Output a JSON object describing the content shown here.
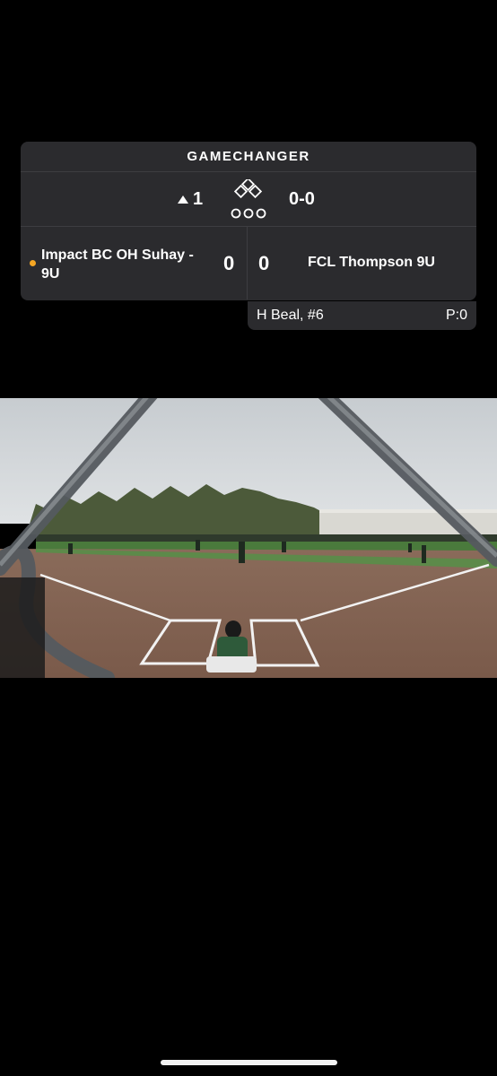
{
  "scoreboard": {
    "brand": "GAMECHANGER",
    "inning": "1",
    "inning_half": "top",
    "count": "0-0",
    "away_team": "Impact BC OH Suhay - 9U",
    "away_score": "0",
    "home_team": "FCL Thompson 9U",
    "home_score": "0",
    "possession_color": "#f5a623"
  },
  "batter": {
    "name": "H Beal, #6",
    "pitch_count": "P:0"
  },
  "video": {
    "description_icon": "baseball-field-camera-view"
  }
}
